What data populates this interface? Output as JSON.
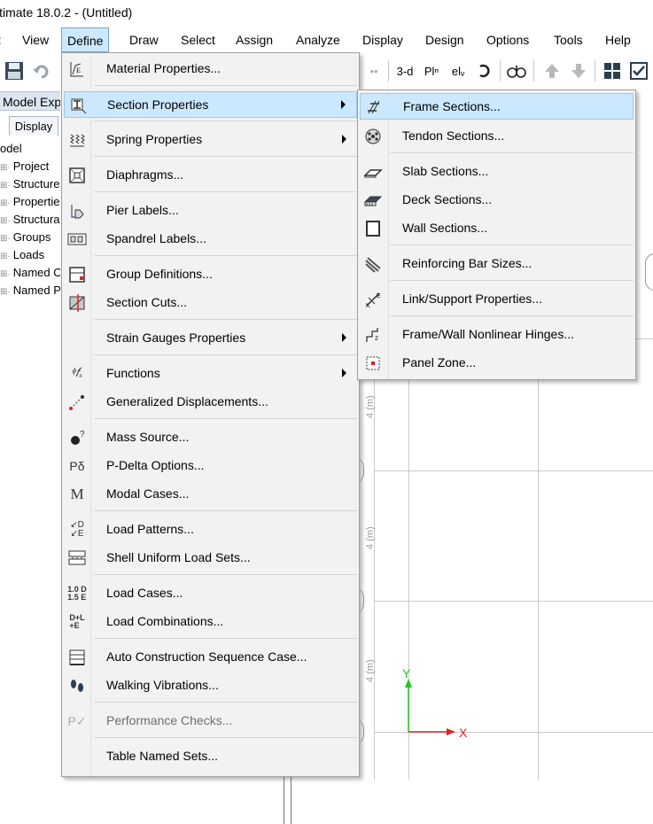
{
  "window": {
    "title": "ltimate 18.0.2 - (Untitled)"
  },
  "menubar": [
    {
      "label": "View"
    },
    {
      "label": "Define"
    },
    {
      "label": "Draw"
    },
    {
      "label": "Select"
    },
    {
      "label": "Assign"
    },
    {
      "label": "Analyze"
    },
    {
      "label": "Display"
    },
    {
      "label": "Design"
    },
    {
      "label": "Options"
    },
    {
      "label": "Tools"
    },
    {
      "label": "Help"
    }
  ],
  "toolbar": {
    "view_3d": "3-d",
    "plan": "Plⁿ",
    "elev": "elᵥ"
  },
  "explorer": {
    "title": "Model Exp",
    "tab": "Display",
    "tree": [
      "odel",
      "Project",
      "Structure",
      "Properties",
      "Structural",
      "Groups",
      "Loads",
      "Named O",
      "Named Pl"
    ]
  },
  "define_menu": {
    "items": [
      {
        "label": "Material Properties...",
        "icon": "material-icon"
      },
      {
        "label": "Section Properties",
        "icon": "section-icon",
        "submenu": true
      },
      {
        "label": "Spring Properties",
        "icon": "spring-icon",
        "submenu": true
      },
      {
        "label": "Diaphragms...",
        "icon": "diaphragm-icon"
      },
      {
        "label": "Pier Labels...",
        "icon": "pier-icon"
      },
      {
        "label": "Spandrel Labels...",
        "icon": "spandrel-icon"
      },
      {
        "label": "Group Definitions...",
        "icon": "group-icon"
      },
      {
        "label": "Section Cuts...",
        "icon": "section-cut-icon"
      },
      {
        "label": "Strain Gauges Properties",
        "submenu": true
      },
      {
        "label": "Functions",
        "icon": "function-icon",
        "submenu": true
      },
      {
        "label": "Generalized Displacements...",
        "icon": "displacement-icon"
      },
      {
        "label": "Mass Source...",
        "icon": "mass-icon"
      },
      {
        "label": "P-Delta Options...",
        "icon": "pdelta-icon",
        "icon_text": "Pδ"
      },
      {
        "label": "Modal Cases...",
        "icon": "modal-icon",
        "icon_text": "M"
      },
      {
        "label": "Load Patterns...",
        "icon": "load-pattern-icon"
      },
      {
        "label": "Shell Uniform Load Sets...",
        "icon": "shell-load-icon"
      },
      {
        "label": "Load Cases...",
        "icon": "load-case-icon",
        "icon_text": "1.0 D\n1.5 E"
      },
      {
        "label": "Load Combinations...",
        "icon": "load-combo-icon",
        "icon_text": "D+L\n+E"
      },
      {
        "label": "Auto Construction Sequence Case...",
        "icon": "construction-icon"
      },
      {
        "label": "Walking Vibrations...",
        "icon": "footprint-icon"
      },
      {
        "label": "Performance Checks...",
        "icon": "performance-icon",
        "disabled": true
      },
      {
        "label": "Table Named Sets..."
      }
    ]
  },
  "section_submenu": {
    "items": [
      {
        "label": "Frame Sections...",
        "icon": "frame-section-icon"
      },
      {
        "label": "Tendon Sections...",
        "icon": "tendon-icon"
      },
      {
        "label": "Slab Sections...",
        "icon": "slab-icon"
      },
      {
        "label": "Deck Sections...",
        "icon": "deck-icon"
      },
      {
        "label": "Wall Sections...",
        "icon": "wall-icon"
      },
      {
        "label": "Reinforcing Bar Sizes...",
        "icon": "rebar-icon"
      },
      {
        "label": "Link/Support Properties...",
        "icon": "link-icon"
      },
      {
        "label": "Frame/Wall Nonlinear Hinges...",
        "icon": "hinge-icon"
      },
      {
        "label": "Panel Zone...",
        "icon": "panel-zone-icon"
      }
    ]
  },
  "canvas": {
    "dim_label": "4 (m)",
    "axis_y": "Y",
    "axis_x": "X",
    "axis_color": "#1ec81e",
    "axis_x_color": "#e02020"
  }
}
